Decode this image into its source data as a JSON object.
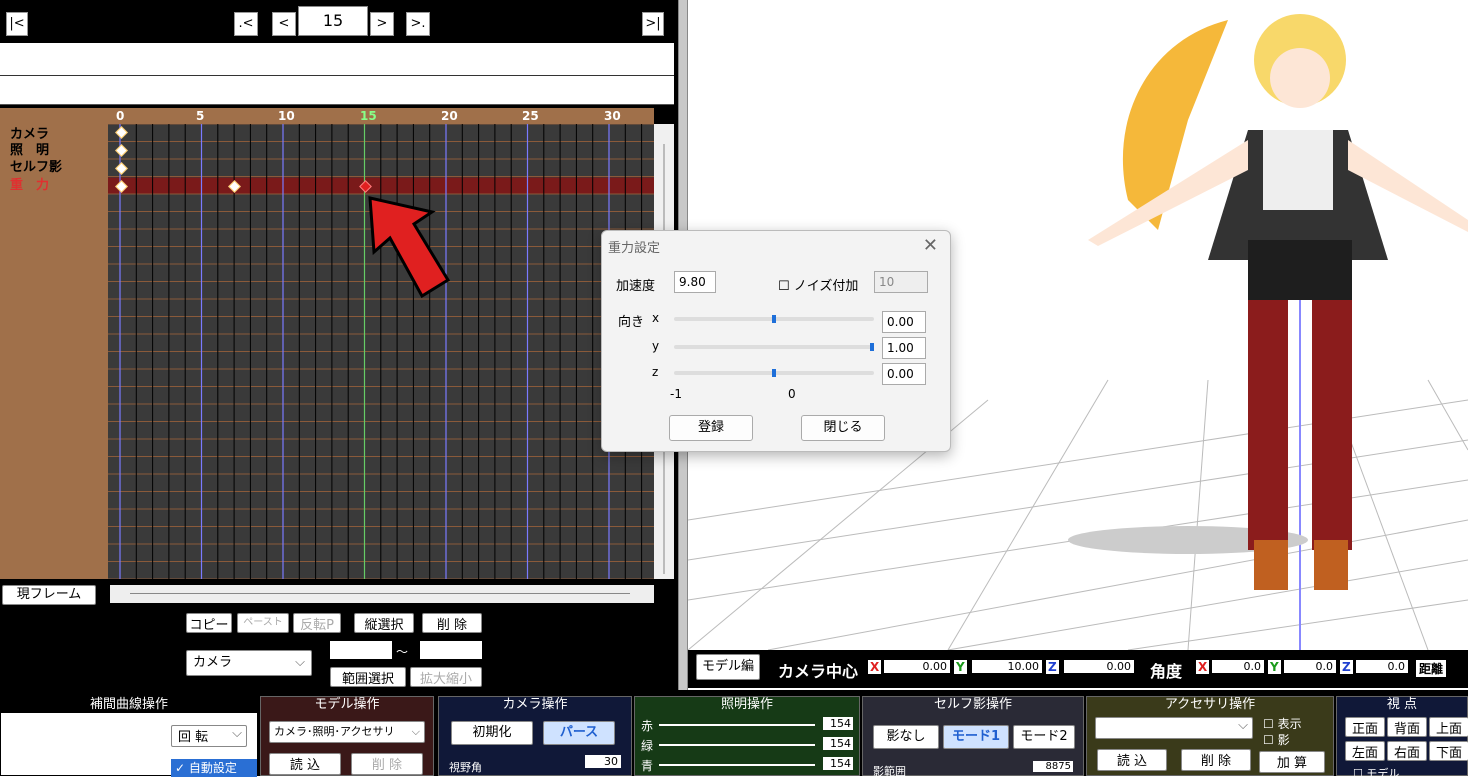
{
  "nav": {
    "first": "|<",
    "prev_key": ".<",
    "prev": "<",
    "frame": "15",
    "next": ">",
    "next_key": ">.",
    "last": ">|"
  },
  "ruler": [
    "0",
    "5",
    "10",
    "15",
    "20",
    "25",
    "30"
  ],
  "tracks": [
    "カメラ",
    "照　明",
    "セルフ影",
    "重　力"
  ],
  "current_frame_btn": "現フレーム",
  "edit": {
    "copy": "コピー",
    "paste": "ペースト",
    "reverse": "反転P",
    "vselect": "縦選択",
    "delete": "削 除",
    "range": "範囲選択",
    "scale": "拡大縮小",
    "tilde": "〜",
    "target": "カメラ"
  },
  "dialog": {
    "title": "重力設定",
    "accel_label": "加速度",
    "accel_value": "9.80",
    "noise_label": "ノイズ付加",
    "noise_value": "10",
    "dir_label": "向き",
    "x_label": "x",
    "y_label": "y",
    "z_label": "z",
    "x_value": "0.00",
    "y_value": "1.00",
    "z_value": "0.00",
    "scale_min": "-1",
    "scale_mid": "0",
    "register": "登録",
    "close": "閉じる"
  },
  "infobar": {
    "model_edit": "モデル編",
    "camera_center": "カメラ中心",
    "X": "X",
    "Y": "Y",
    "Z": "Z",
    "cx": "0.00",
    "cy": "10.00",
    "cz": "0.00",
    "angle": "角度",
    "ax": "0.0",
    "ay": "0.0",
    "az": "0.0",
    "distance": "距離"
  },
  "panels": {
    "interp": {
      "title": "補間曲線操作",
      "rot": "回 転",
      "auto": "自動設定"
    },
    "model": {
      "title": "モデル操作",
      "select": "カメラ･照明･アクセサリ",
      "load": "読 込",
      "delete": "削 除"
    },
    "camera": {
      "title": "カメラ操作",
      "init": "初期化",
      "perspective": "パース",
      "fov_label": "視野角",
      "fov": "30"
    },
    "light": {
      "title": "照明操作",
      "r": "赤",
      "g": "緑",
      "b": "青",
      "rv": "154",
      "gv": "154",
      "bv": "154"
    },
    "selfshadow": {
      "title": "セルフ影操作",
      "none": "影なし",
      "mode1": "モード1",
      "mode2": "モード2",
      "range": "影範囲",
      "range_val": "8875"
    },
    "accessory": {
      "title": "アクセサリ操作",
      "show": "表示",
      "shadow": "影",
      "load": "読 込",
      "delete": "削 除",
      "add": "加 算"
    },
    "view": {
      "title": "視 点",
      "front": "正面",
      "back": "背面",
      "top": "上面",
      "left": "左面",
      "right": "右面",
      "bottom": "下面",
      "model": "モデル"
    }
  },
  "colors": {
    "timeline_bg": "#3a3a3a",
    "track_label_bg": "#a0704a",
    "arrow": "#e02020",
    "selected_row": "#7a1a1a"
  }
}
